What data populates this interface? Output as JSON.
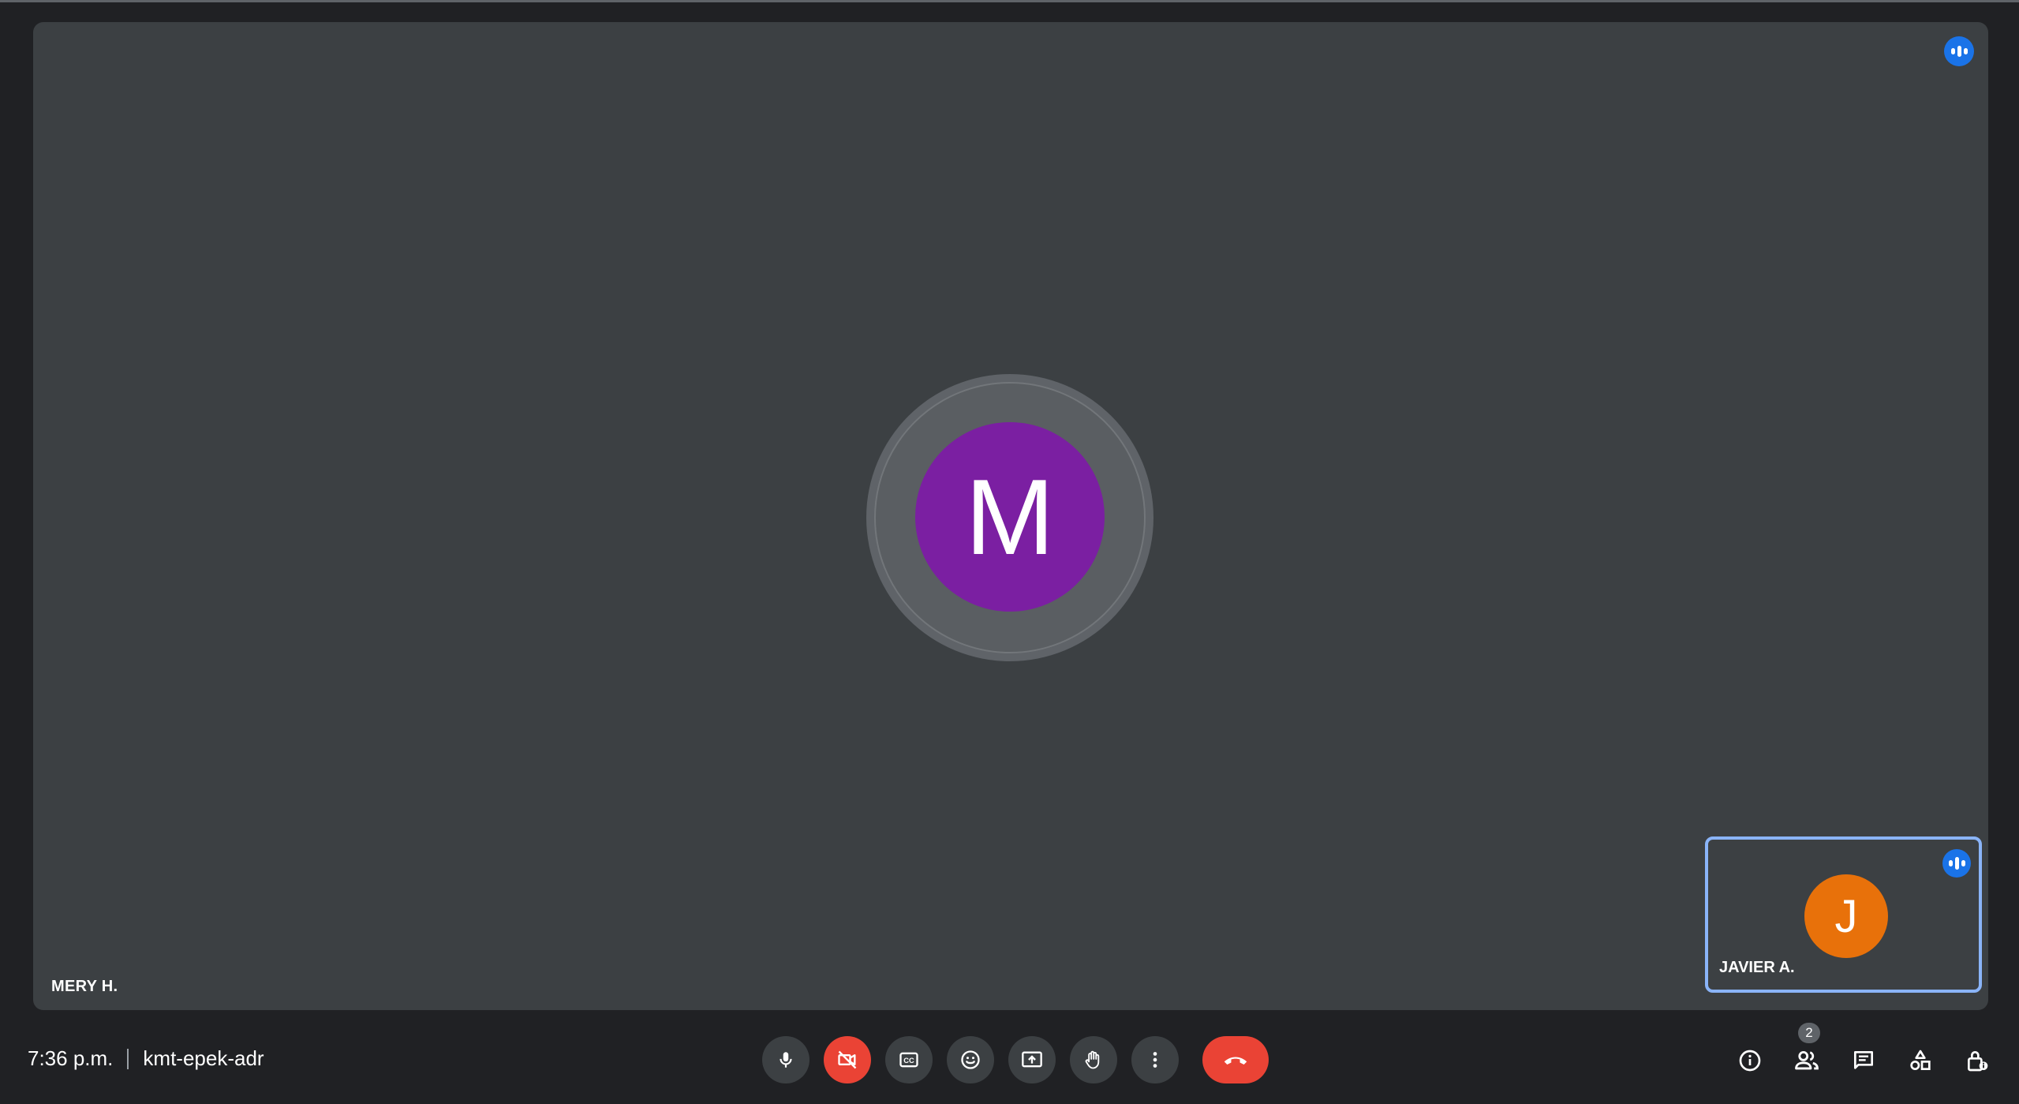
{
  "main_tile": {
    "participant_name": "MERY H.",
    "avatar_initial": "M",
    "avatar_color": "#7b1fa2",
    "speaking_indicator": "speaking-icon"
  },
  "self_tile": {
    "participant_name": "JAVIER A.",
    "avatar_initial": "J",
    "avatar_color": "#e8710a",
    "highlight_color": "#8ab4f8",
    "speaking_indicator": "speaking-icon"
  },
  "bottom_bar": {
    "time": "7:36 p.m.",
    "meeting_code": "kmt-epek-adr"
  },
  "controls": [
    {
      "name": "microphone-icon",
      "state": "on"
    },
    {
      "name": "camera-off-icon",
      "state": "off"
    },
    {
      "name": "captions-icon"
    },
    {
      "name": "emoji-icon"
    },
    {
      "name": "present-screen-icon"
    },
    {
      "name": "raise-hand-icon"
    },
    {
      "name": "more-options-icon"
    },
    {
      "name": "end-call-icon"
    }
  ],
  "side_controls": {
    "info": "info-icon",
    "people": "people-icon",
    "people_count": "2",
    "chat": "chat-icon",
    "activities": "activities-icon",
    "host_controls": "host-controls-icon"
  },
  "colors": {
    "background": "#202124",
    "tile": "#3c4043",
    "danger": "#ea4335",
    "accent": "#1a73e8"
  }
}
